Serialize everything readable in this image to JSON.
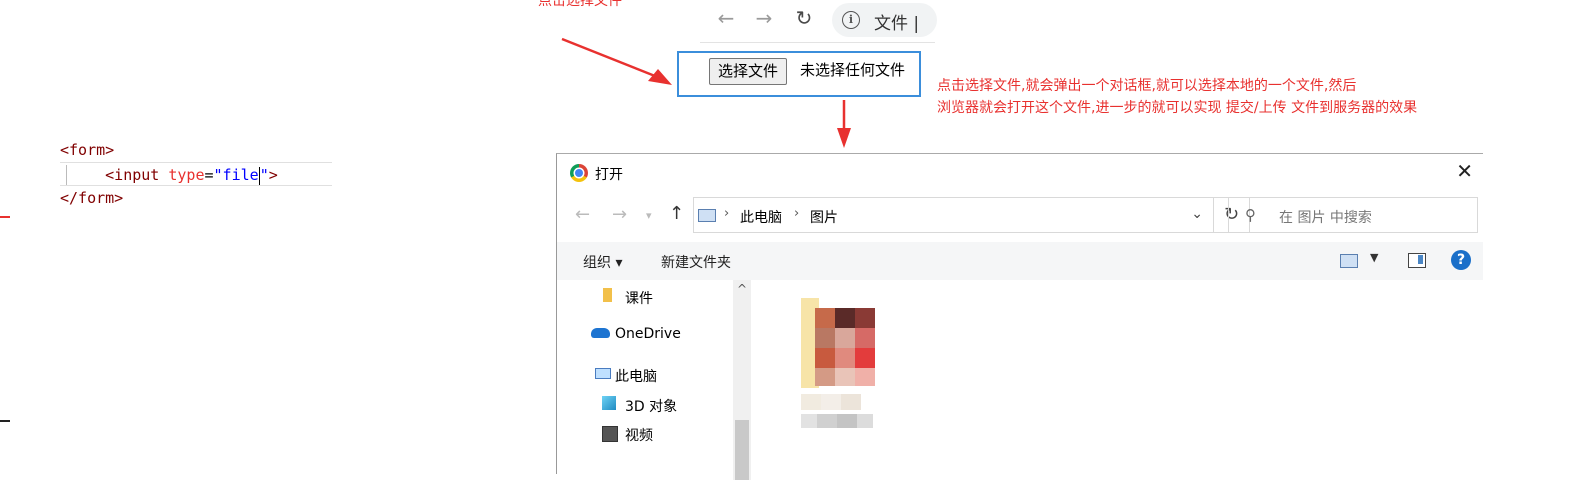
{
  "top_annotation": "点击选择文件",
  "browser": {
    "back_icon": "arrow-left-icon",
    "forward_icon": "arrow-right-icon",
    "reload_icon": "reload-icon",
    "info_icon": "info-icon",
    "url_text": "文件 |"
  },
  "file_input": {
    "button_label": "选择文件",
    "status_text": "未选择任何文件"
  },
  "right_annotation": {
    "line1": "点击选择文件,就会弹出一个对话框,就可以选择本地的一个文件,然后",
    "line2": "浏览器就会打开这个文件,进一步的就可以实现 提交/上传 文件到服务器的效果"
  },
  "code": {
    "line1": "<form>",
    "line2_open": "<input ",
    "line2_attr": "type",
    "line2_eq": "=",
    "line2_val_a": "\"file",
    "line2_val_b": "\"",
    "line2_close": ">",
    "line3": "</form>"
  },
  "dialog": {
    "title": "打开",
    "path": [
      "此电脑",
      "图片"
    ],
    "search_placeholder": "在 图片 中搜索",
    "toolbar": {
      "organize": "组织 ▾",
      "new_folder": "新建文件夹",
      "help": "?"
    },
    "nav_items": [
      "课件",
      "OneDrive",
      "此电脑",
      "3D 对象",
      "视频"
    ]
  },
  "colors": {
    "annotation": "#e8312f",
    "highlight_border": "#3b8edb"
  }
}
